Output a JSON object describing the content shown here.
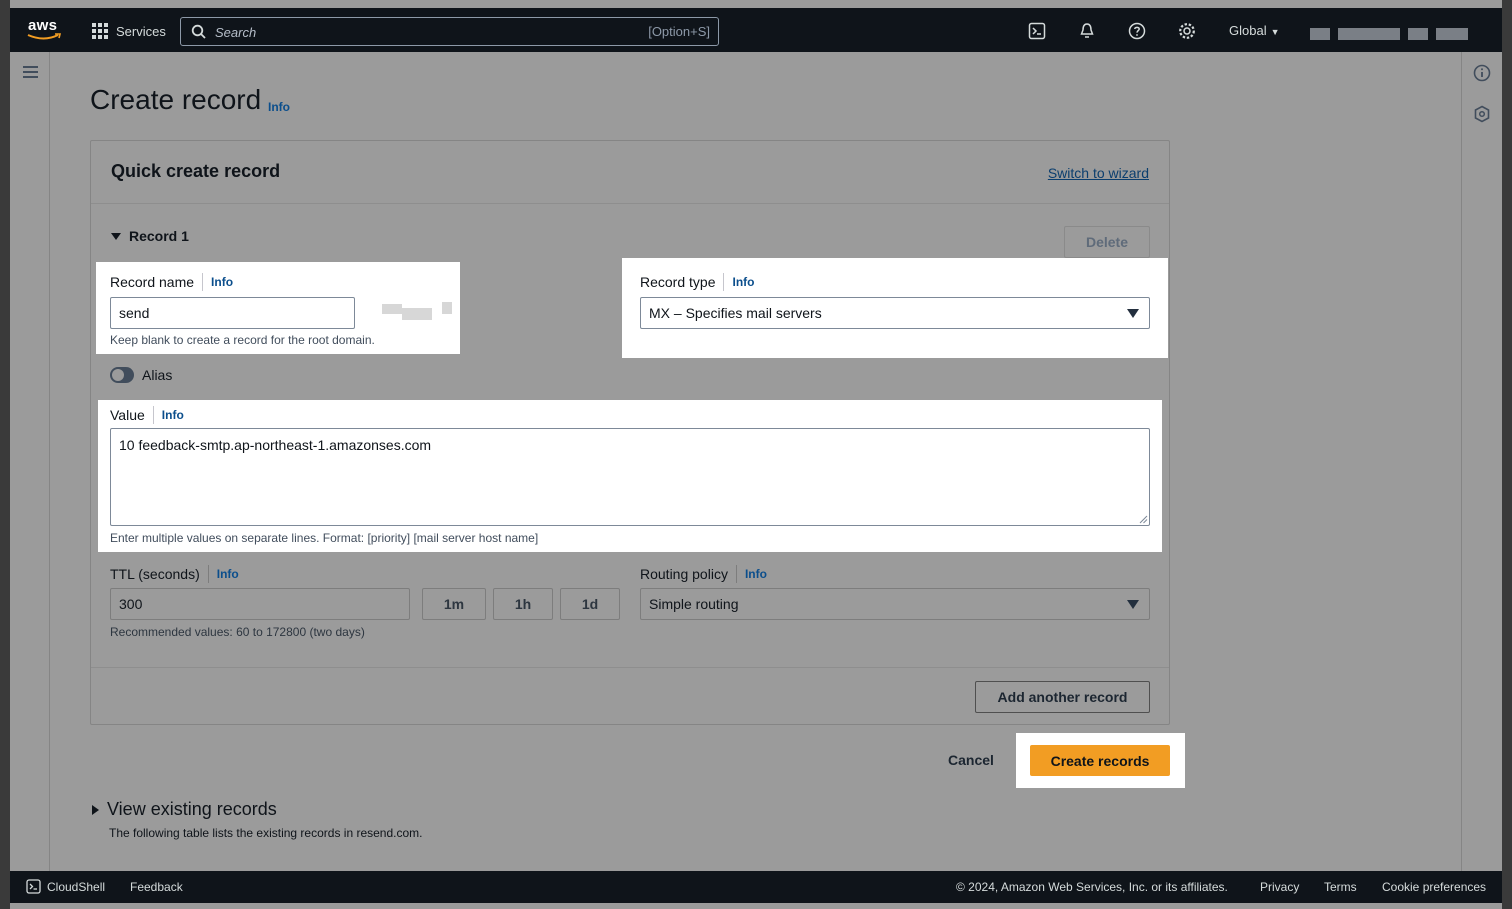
{
  "topnav": {
    "services_label": "Services",
    "search_placeholder": "Search",
    "search_shortcut": "[Option+S]",
    "region_label": "Global"
  },
  "page": {
    "title": "Create record",
    "title_info": "Info"
  },
  "card": {
    "title": "Quick create record",
    "switch_link": "Switch to wizard",
    "record_label": "Record 1",
    "delete_label": "Delete"
  },
  "record_name": {
    "label": "Record name",
    "info": "Info",
    "value": "send",
    "hint": "Keep blank to create a record for the root domain."
  },
  "record_type": {
    "label": "Record type",
    "info": "Info",
    "selected": "MX – Specifies mail servers"
  },
  "alias": {
    "label": "Alias",
    "enabled": false
  },
  "value_field": {
    "label": "Value",
    "info": "Info",
    "value": "10 feedback-smtp.ap-northeast-1.amazonses.com",
    "hint": "Enter multiple values on separate lines. Format: [priority] [mail server host name]"
  },
  "ttl": {
    "label": "TTL (seconds)",
    "info": "Info",
    "value": "300",
    "preset_1m": "1m",
    "preset_1h": "1h",
    "preset_1d": "1d",
    "hint": "Recommended values: 60 to 172800 (two days)"
  },
  "routing": {
    "label": "Routing policy",
    "info": "Info",
    "selected": "Simple routing"
  },
  "actions": {
    "add_another": "Add another record",
    "cancel": "Cancel",
    "create": "Create records"
  },
  "existing": {
    "title": "View existing records",
    "description": "The following table lists the existing records in resend.com."
  },
  "footer": {
    "cloudshell": "CloudShell",
    "feedback": "Feedback",
    "copyright": "© 2024, Amazon Web Services, Inc. or its affiliates.",
    "privacy": "Privacy",
    "terms": "Terms",
    "cookies": "Cookie preferences"
  },
  "colors": {
    "primary_button": "#f29d23",
    "link": "#0b4e8c",
    "nav_background": "#0f141a"
  }
}
